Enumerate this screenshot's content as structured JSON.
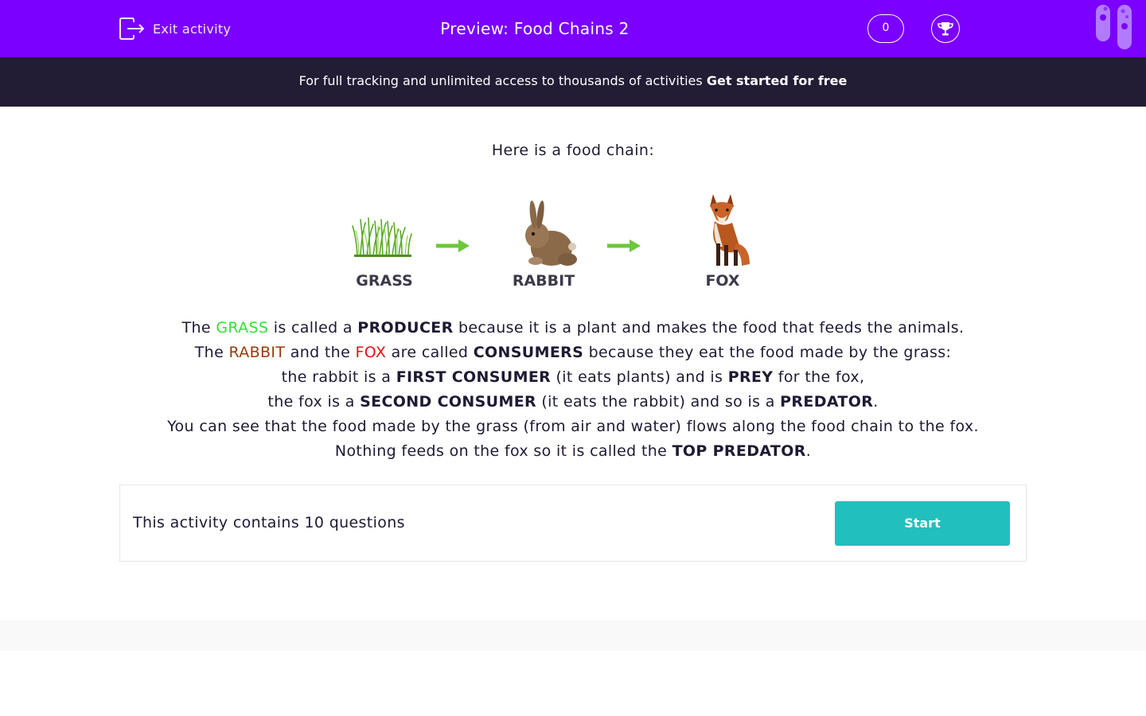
{
  "header": {
    "exit_label": "Exit activity",
    "title": "Preview: Food Chains 2",
    "score": "0",
    "bg_color": "#7b00ff"
  },
  "promo": {
    "text": "For full tracking and unlimited access to thousands of activities ",
    "cta": "Get started for free"
  },
  "content": {
    "intro": "Here is a food chain:",
    "chain": [
      {
        "label": "GRASS",
        "icon": "grass-image"
      },
      {
        "label": "RABBIT",
        "icon": "rabbit-image"
      },
      {
        "label": "FOX",
        "icon": "fox-image"
      }
    ],
    "explanation": {
      "l1": {
        "a": "The ",
        "grass": "GRASS",
        "b": " is called a ",
        "producer": "PRODUCER",
        "c": " because it is a plant and makes the food that feeds the animals."
      },
      "l2": {
        "a": "The ",
        "rabbit": "RABBIT",
        "b": " and the ",
        "fox": "FOX",
        "c": " are called ",
        "consumers": "CONSUMERS",
        "d": " because they eat the food made by the grass:"
      },
      "l3": {
        "a": "the rabbit is a ",
        "first": "FIRST CONSUMER",
        "b": " (it eats plants) and is ",
        "prey": "PREY",
        "c": " for the fox,"
      },
      "l4": {
        "a": "the fox is a ",
        "second": "SECOND CONSUMER",
        "b": " (it eats the rabbit) and so is a ",
        "predator": "PREDATOR",
        "c": "."
      },
      "l5": "You can see that the food made by the grass (from air and water) flows along the food chain to the fox.",
      "l6": {
        "a": "Nothing feeds on the fox so it is called the ",
        "top": "TOP PREDATOR",
        "b": "."
      }
    },
    "colors": {
      "grass": "#36e03a",
      "rabbit": "#9a3b06",
      "fox": "#e81010",
      "arrow": "#6cc83a"
    }
  },
  "card": {
    "text": "This activity contains 10 questions",
    "start_label": "Start",
    "button_color": "#22bfbf"
  }
}
